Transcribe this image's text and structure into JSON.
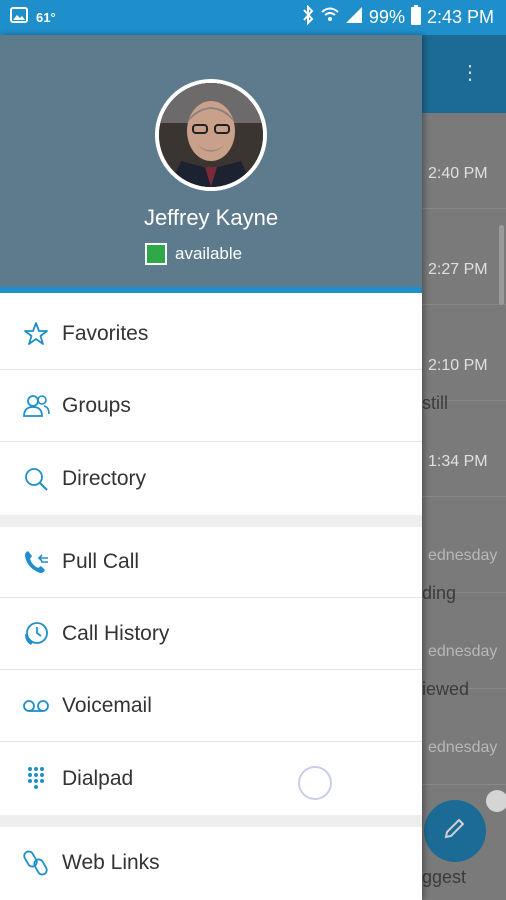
{
  "status_bar": {
    "temperature": "61°",
    "battery": "99%",
    "time": "2:43 PM"
  },
  "drawer": {
    "user": {
      "name": "Jeffrey Kayne",
      "presence": "available",
      "presence_color": "#2ea94a"
    },
    "menu": [
      {
        "label": "Favorites",
        "icon": "star-icon"
      },
      {
        "label": "Groups",
        "icon": "group-icon"
      },
      {
        "label": "Directory",
        "icon": "search-icon"
      },
      {
        "label": "Pull Call",
        "icon": "pull-call-icon"
      },
      {
        "label": "Call History",
        "icon": "call-history-icon"
      },
      {
        "label": "Voicemail",
        "icon": "voicemail-icon"
      },
      {
        "label": "Dialpad",
        "icon": "dialpad-icon"
      },
      {
        "label": "Web Links",
        "icon": "link-icon"
      }
    ]
  },
  "background_list": {
    "rows": [
      {
        "time": "2:40 PM",
        "snippet": ""
      },
      {
        "time": "2:27 PM",
        "snippet": ""
      },
      {
        "time": "2:10 PM",
        "snippet": "still"
      },
      {
        "time": "1:34 PM",
        "snippet": ""
      },
      {
        "time": "ednesday",
        "snippet": "ding"
      },
      {
        "time": "ednesday",
        "snippet": "iewed"
      },
      {
        "time": "ednesday",
        "snippet": ""
      },
      {
        "time": "",
        "snippet": "ggest"
      }
    ]
  },
  "colors": {
    "accent": "#1f8fcb",
    "header": "#5e7a8d"
  }
}
